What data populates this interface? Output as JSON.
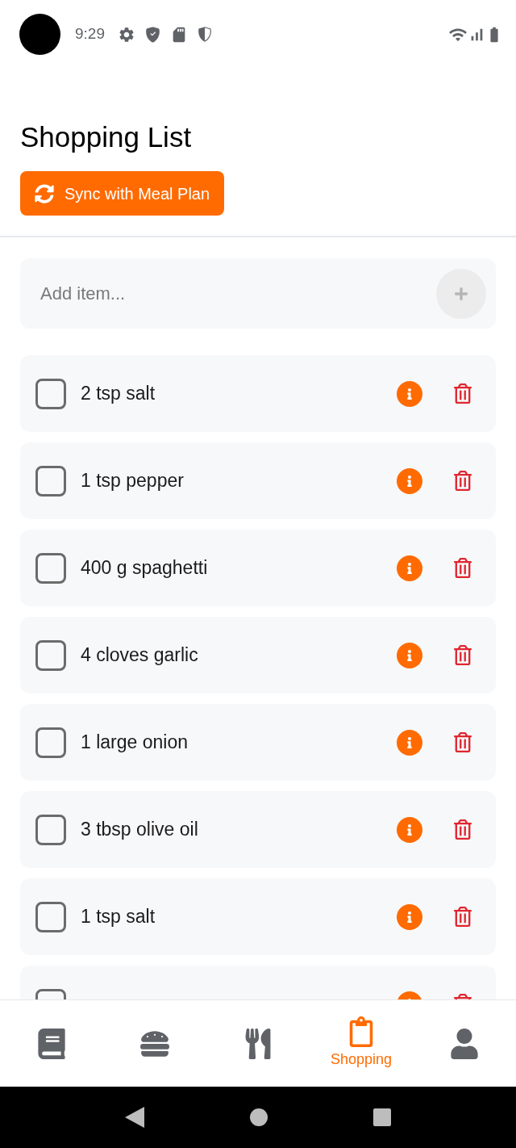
{
  "status_bar": {
    "time": "9:29"
  },
  "header": {
    "title": "Shopping List",
    "sync_button": "Sync with Meal Plan"
  },
  "add_item": {
    "placeholder": "Add item..."
  },
  "items": [
    {
      "text": "2 tsp salt",
      "checked": false
    },
    {
      "text": "1 tsp pepper",
      "checked": false
    },
    {
      "text": "400 g spaghetti",
      "checked": false
    },
    {
      "text": "4 cloves garlic",
      "checked": false
    },
    {
      "text": "1 large onion",
      "checked": false
    },
    {
      "text": "3 tbsp olive oil",
      "checked": false
    },
    {
      "text": "1 tsp salt",
      "checked": false
    },
    {
      "checked": false
    }
  ],
  "tabs": [
    {
      "kind": "book",
      "selected": false
    },
    {
      "kind": "burger",
      "selected": false
    },
    {
      "kind": "utensils",
      "selected": false
    },
    {
      "kind": "clipboard",
      "selected": true,
      "label": "Shopping"
    },
    {
      "kind": "user",
      "selected": false
    }
  ]
}
